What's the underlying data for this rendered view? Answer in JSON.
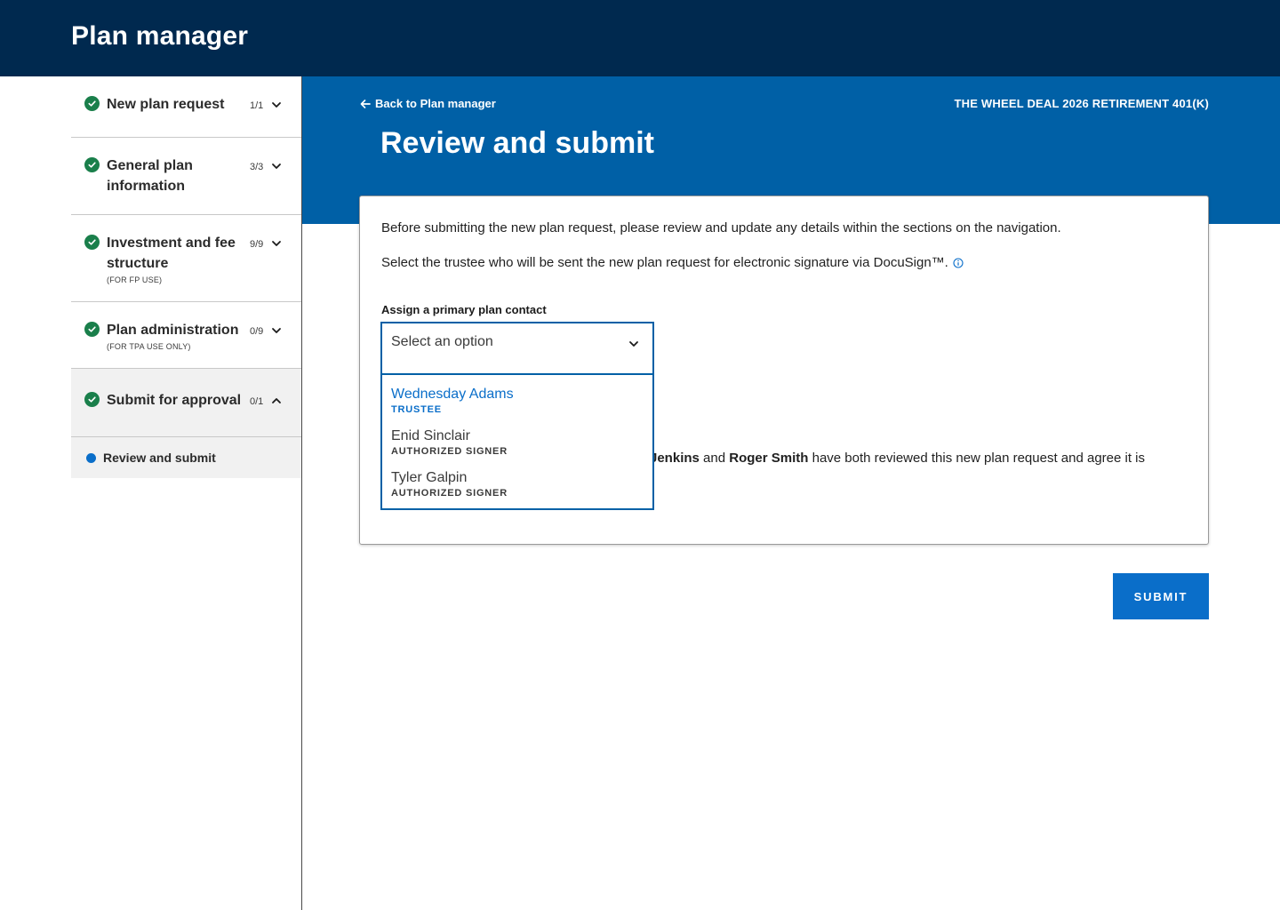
{
  "app": {
    "title": "Plan manager"
  },
  "sidebar": {
    "items": [
      {
        "label": "New plan request",
        "count": "1/1",
        "status_icon": "check-circle-icon",
        "chevron": "chevron-down-icon"
      },
      {
        "label": "General plan information",
        "count": "3/3",
        "status_icon": "check-circle-icon",
        "chevron": "chevron-down-icon"
      },
      {
        "label": "Investment and fee structure",
        "note": "(FOR FP USE)",
        "count": "9/9",
        "status_icon": "check-circle-icon",
        "chevron": "chevron-down-icon"
      },
      {
        "label": "Plan administration",
        "note": "(FOR TPA USE ONLY)",
        "count": "0/9",
        "status_icon": "check-circle-icon",
        "chevron": "chevron-down-icon"
      },
      {
        "label": "Submit for approval",
        "count": "0/1",
        "status_icon": "check-circle-icon",
        "chevron": "chevron-up-icon"
      }
    ],
    "sub_items": [
      {
        "label": "Review and submit"
      }
    ]
  },
  "header": {
    "back_label": "Back to Plan manager",
    "plan_name": "THE WHEEL DEAL 2026 RETIREMENT 401(K)",
    "page_title": "Review and submit"
  },
  "card": {
    "intro": "Before submitting the new plan request, please review and update any details within the sections on the navigation.",
    "trustee_text": "Select the trustee who will be sent the new plan request for electronic signature via DocuSign™.",
    "field_label": "Assign a primary plan contact",
    "select_placeholder": "Select an option",
    "attestation": {
      "name_1": "Jenkins",
      "connector": " and ",
      "name_2": "Roger Smith",
      "tail": " have both reviewed this new plan request and agree it is"
    }
  },
  "dropdown": {
    "options": [
      {
        "name": "Wednesday Adams",
        "role": "TRUSTEE",
        "highlighted": true
      },
      {
        "name": "Enid Sinclair",
        "role": "AUTHORIZED SIGNER"
      },
      {
        "name": "Tyler Galpin",
        "role": "AUTHORIZED SIGNER"
      }
    ]
  },
  "actions": {
    "submit_label": "SUBMIT"
  },
  "colors": {
    "topbar": "#00294f",
    "hero": "#0060a6",
    "accent": "#0a6ec9",
    "success": "#1a7f4b"
  }
}
